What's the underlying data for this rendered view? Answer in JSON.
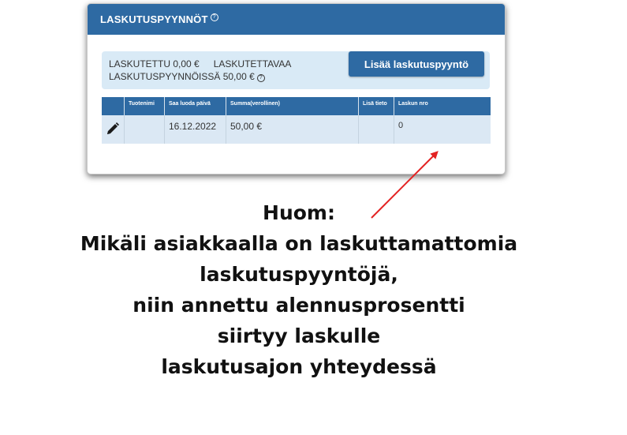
{
  "panel": {
    "title": "LASKUTUSPYYNNÖT",
    "help_glyph": "?"
  },
  "summary": {
    "invoiced_label": "LASKUTETTU 0,00 €",
    "to_invoice_label": "LASKUTETTAVAA",
    "requests_label": "LASKUTUSPYYNNÖISSÄ 50,00 €",
    "help_glyph": "?"
  },
  "add_button": {
    "label": "Lisää laskutuspyyntö"
  },
  "table": {
    "headers": [
      "",
      "Tuotenimi",
      "Saa luoda päivä",
      "Summa(verollinen)",
      "Lisä tieto",
      "Laskun nro"
    ],
    "rows": [
      {
        "product": "",
        "date": "16.12.2022",
        "amount": "50,00 €",
        "extra": "",
        "invoice_no": "0"
      }
    ]
  },
  "icons": {
    "edit": "pencil-icon",
    "help": "help-circle-icon"
  },
  "colors": {
    "primary": "#2e6aa3",
    "summary_bg": "#d9eaf6",
    "row_bg": "#dbe8f4",
    "arrow": "#e32222"
  },
  "note": {
    "lines": [
      "Huom:",
      "Mikäli asiakkaalla on laskuttamattomia",
      "laskutuspyyntöjä,",
      "niin annettu alennusprosentti",
      "siirtyy laskulle",
      "laskutusajon yhteydessä"
    ]
  }
}
